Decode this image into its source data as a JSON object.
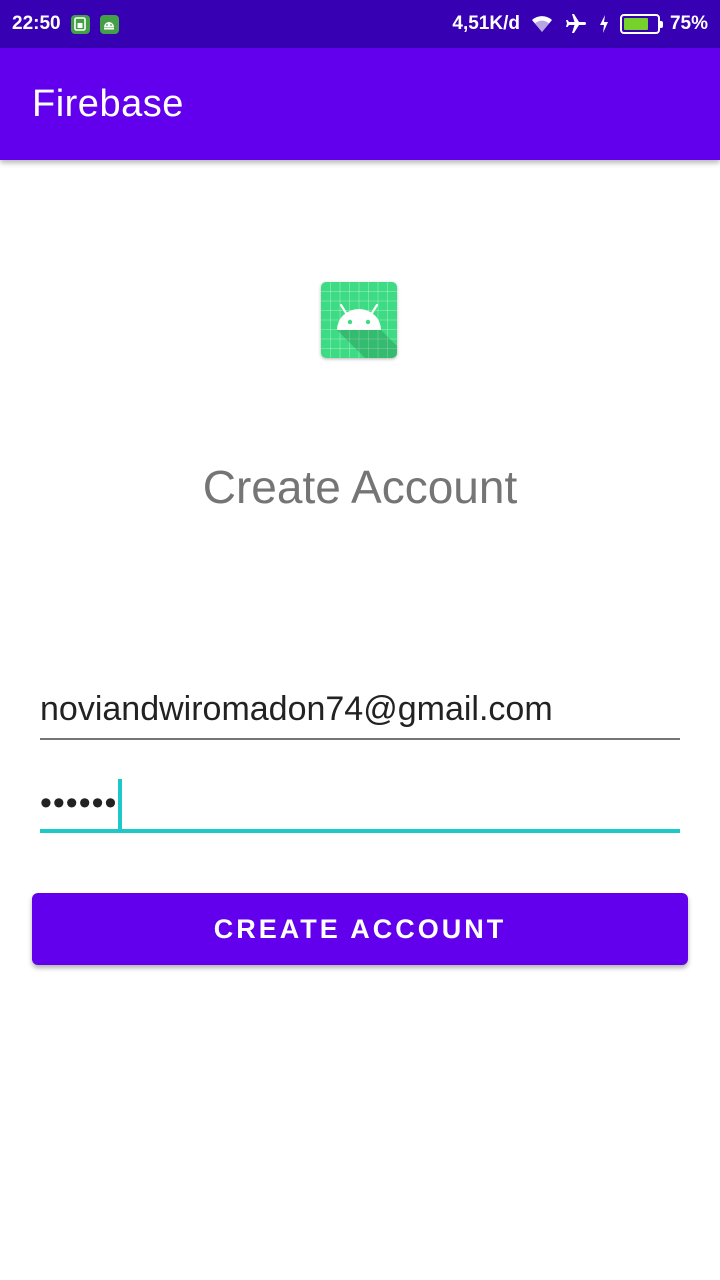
{
  "status_bar": {
    "time": "22:50",
    "network_speed": "4,51K/d",
    "battery_percent": "75%",
    "battery_level": 0.75,
    "icons": [
      "sim-notification-icon",
      "android-notification-icon",
      "wifi-icon",
      "airplane-mode-icon",
      "charging-icon",
      "battery-icon"
    ]
  },
  "app_bar": {
    "title": "Firebase",
    "color": "#6200ee"
  },
  "main": {
    "logo_icon": "android-app-icon",
    "heading": "Create Account",
    "email_value": "noviandwiromadon74@gmail.com",
    "password_value": "••••••",
    "button_label": "CREATE ACCOUNT"
  },
  "colors": {
    "status_bar": "#3700b3",
    "primary": "#6200ee",
    "accent": "#1ec8c8",
    "logo_green": "#3ddc84"
  }
}
